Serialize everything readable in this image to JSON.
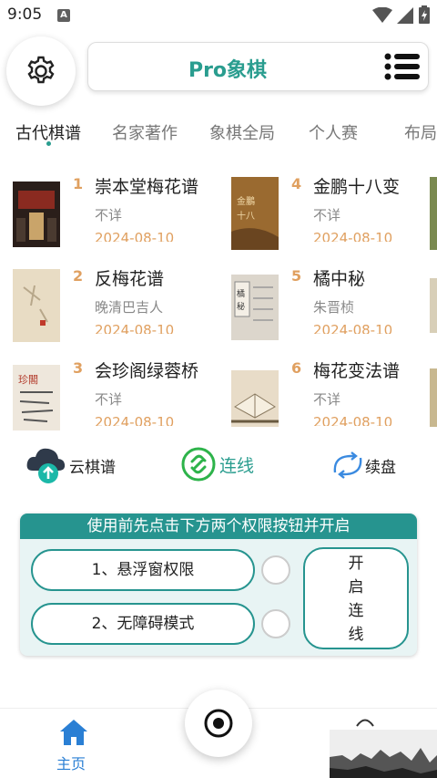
{
  "status": {
    "time": "9:05",
    "a_icon": "A"
  },
  "header": {
    "title": "Pro象棋",
    "settings_icon": "gear-icon",
    "menu_icon": "list-icon"
  },
  "tabs": [
    {
      "label": "古代棋谱",
      "active": true
    },
    {
      "label": "名家著作",
      "active": false
    },
    {
      "label": "象棋全局",
      "active": false
    },
    {
      "label": "个人赛",
      "active": false
    },
    {
      "label": "布局",
      "active": false
    }
  ],
  "books": [
    {
      "num": "1",
      "title": "崇本堂梅花谱",
      "author": "不详",
      "date": "2024-08-10"
    },
    {
      "num": "2",
      "title": "反梅花谱",
      "author": "晚清巴吉人",
      "date": "2024-08-10"
    },
    {
      "num": "3",
      "title": "会珍阁绿蓉桥",
      "author": "不详",
      "date": "2024-08-10"
    },
    {
      "num": "4",
      "title": "金鹏十八变",
      "author": "不详",
      "date": "2024-08-10"
    },
    {
      "num": "5",
      "title": "橘中秘",
      "author": "朱晋桢",
      "date": "2024-08-10"
    },
    {
      "num": "6",
      "title": "梅花变法谱",
      "author": "不详",
      "date": "2024-08-10"
    }
  ],
  "actions": {
    "cloud": {
      "label": "云棋谱",
      "icon": "cloud-upload-icon"
    },
    "connect": {
      "label": "连线",
      "icon": "link-icon"
    },
    "resume": {
      "label": "续盘",
      "icon": "resume-arrows-icon"
    }
  },
  "permissions": {
    "header": "使用前先点击下方两个权限按钮并开启",
    "float_window": "1、悬浮窗权限",
    "accessibility": "2、无障碍模式",
    "start_chars": [
      "开",
      "启",
      "连",
      "线"
    ]
  },
  "bottom_nav": {
    "home_label": "主页",
    "home_icon": "home-icon",
    "center_icon": "target-icon"
  },
  "colors": {
    "accent": "#2a9d8f",
    "number": "#e0a060",
    "nav_blue": "#2a7fd4"
  }
}
